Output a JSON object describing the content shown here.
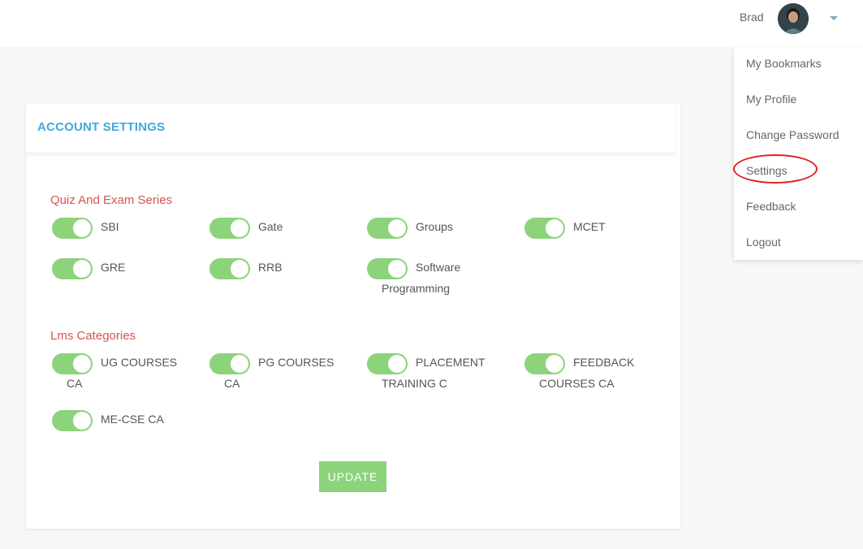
{
  "header": {
    "user_name": "Brad",
    "avatar_icon": "user-avatar",
    "caret_icon": "caret-down-icon"
  },
  "dropdown": {
    "items": [
      {
        "label": "My Bookmarks"
      },
      {
        "label": "My Profile"
      },
      {
        "label": "Change Password"
      },
      {
        "label": "Settings",
        "highlighted": true
      },
      {
        "label": "Feedback"
      },
      {
        "label": "Logout"
      }
    ]
  },
  "settings": {
    "title": "ACCOUNT SETTINGS",
    "sections": [
      {
        "title": "Quiz And Exam Series",
        "options": [
          {
            "line1": "SBI",
            "line2": "",
            "on": true
          },
          {
            "line1": "Gate",
            "line2": "",
            "on": true
          },
          {
            "line1": "Groups",
            "line2": "",
            "on": true
          },
          {
            "line1": "MCET",
            "line2": "",
            "on": true
          },
          {
            "line1": "GRE",
            "line2": "",
            "on": true
          },
          {
            "line1": "RRB",
            "line2": "",
            "on": true
          },
          {
            "line1": "Software",
            "line2": "Programming",
            "on": true
          }
        ]
      },
      {
        "title": "Lms Categories",
        "options": [
          {
            "line1": "UG COURSES",
            "line2": "CA",
            "on": true
          },
          {
            "line1": "PG COURSES",
            "line2": "CA",
            "on": true
          },
          {
            "line1": "PLACEMENT",
            "line2": "TRAINING C",
            "on": true
          },
          {
            "line1": "FEEDBACK",
            "line2": "COURSES CA",
            "on": true
          },
          {
            "line1": "ME-CSE CA",
            "line2": "",
            "on": true
          }
        ]
      }
    ],
    "update_label": "UPDATE"
  },
  "colors": {
    "accent_blue": "#3fa7e1",
    "section_red": "#d9534f",
    "toggle_green": "#8cd37b",
    "highlight_ring": "#e02020"
  }
}
